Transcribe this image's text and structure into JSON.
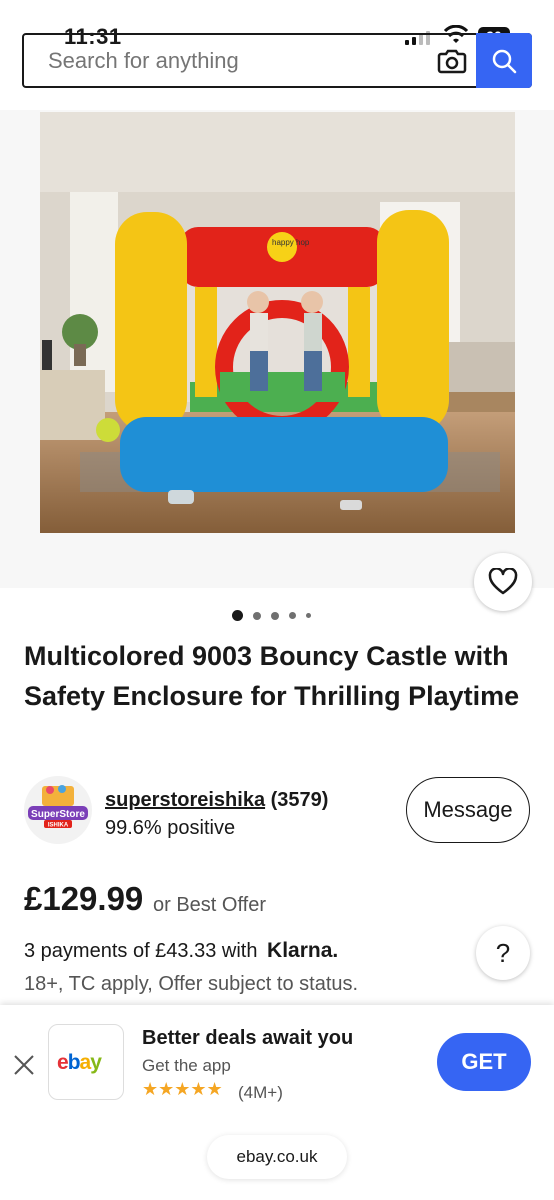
{
  "status_bar": {
    "time": "11:31",
    "battery": "90"
  },
  "search": {
    "placeholder": "Search for anything",
    "value": ""
  },
  "gallery": {
    "image_count": 5,
    "current_index": 1,
    "image_label": "happy hop"
  },
  "product": {
    "title": "Multicolored 9003 Bouncy Castle with Safety Enclosure for Thrilling Playtime",
    "price": "£129.99",
    "offer_text": "or Best Offer",
    "payments_text": "3 payments of £43.33 with",
    "klarna_label": "Klarna.",
    "terms_text": "18+, TC apply, Offer subject to status."
  },
  "seller": {
    "name": "superstoreishika",
    "feedback_count": "(3579)",
    "positive": "99.6% positive",
    "logo_text": "SuperStore",
    "logo_subtext": "ISHIKA",
    "message_label": "Message"
  },
  "help": {
    "label": "?"
  },
  "app_banner": {
    "title": "Better deals await you",
    "subtitle": "Get the app",
    "stars": "★★★★★",
    "rating_count": "(4M+)",
    "get_label": "GET"
  },
  "url_bar": {
    "domain": "ebay.co.uk"
  },
  "colors": {
    "accent_blue": "#3665f3",
    "star_gold": "#f5a623",
    "text_dark": "#191919"
  },
  "icons": [
    "camera-icon",
    "search-icon",
    "heart-icon",
    "close-icon",
    "ebay-logo"
  ]
}
